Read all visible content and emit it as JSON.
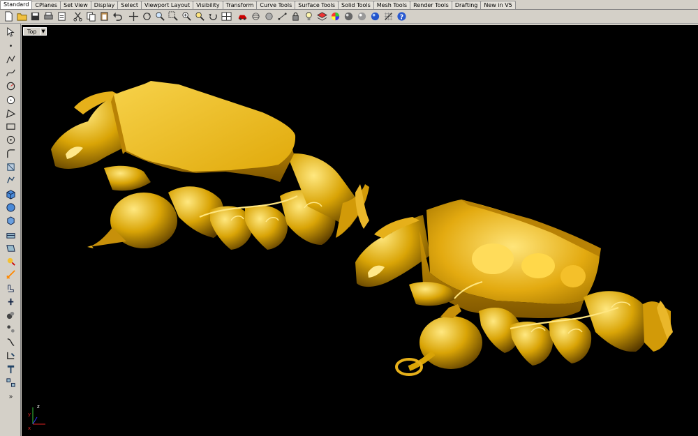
{
  "tabs": [
    "Standard",
    "CPlanes",
    "Set View",
    "Display",
    "Select",
    "Viewport Layout",
    "Visibility",
    "Transform",
    "Curve Tools",
    "Surface Tools",
    "Solid Tools",
    "Mesh Tools",
    "Render Tools",
    "Drafting",
    "New in V5"
  ],
  "active_tab": "Standard",
  "toolbar_icons": [
    "new-file-icon",
    "open-folder-icon",
    "save-icon",
    "print-icon",
    "import-icon",
    "cut-icon",
    "copy-icon",
    "paste-icon",
    "undo-icon",
    "pan-icon",
    "rotate-view-icon",
    "zoom-dynamic-icon",
    "zoom-window-icon",
    "zoom-extents-icon",
    "zoom-selected-icon",
    "undo-view-icon",
    "four-viewports-icon",
    "car-icon",
    "wireframe-icon",
    "shaded-icon",
    "points-on-icon",
    "lock-icon",
    "light-bulb-icon",
    "layer-icon",
    "color-wheel-icon",
    "render-sphere-icon",
    "material-icon",
    "environment-icon",
    "grid-snap-icon",
    "help-icon"
  ],
  "left_tools": [
    "select-arrow-icon",
    "point-icon",
    "polyline-icon",
    "curve-icon",
    "circle-icon",
    "arc-icon",
    "rectangle-icon",
    "polygon-icon",
    "curve-edit-icon",
    "fillet-icon",
    "transform-icon",
    "extrude-icon",
    "box-icon",
    "surface-icon",
    "solid-icon",
    "mesh-icon",
    "explode-icon",
    "light-icon",
    "dimension-icon",
    "boolean-icon",
    "group-icon",
    "join-icon",
    "move-icon",
    "text-icon",
    "snap-icon",
    "array-icon",
    "render-icon",
    "more-icon"
  ],
  "viewport": {
    "name": "Top",
    "dropdown_arrow": "▼"
  },
  "axes": {
    "x": "x",
    "y": "y",
    "z": "z"
  },
  "colors": {
    "gold": "#d9a406",
    "gold_light": "#ffe066",
    "gold_dark": "#7a5500",
    "background": "#000000"
  }
}
